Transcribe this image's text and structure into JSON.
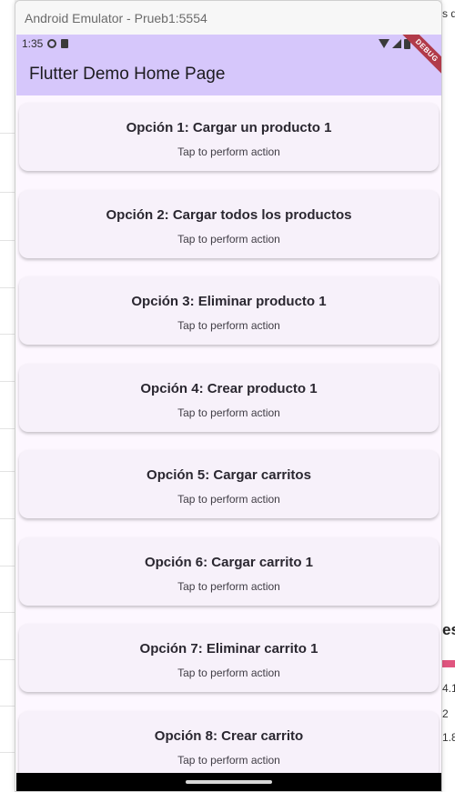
{
  "window": {
    "title": "Android Emulator - Prueb1:5554"
  },
  "status_bar": {
    "time": "1:35"
  },
  "app_bar": {
    "title": "Flutter Demo Home Page",
    "debug_label": "DEBUG"
  },
  "options": [
    {
      "title": "Opción 1: Cargar un producto 1",
      "subtitle": "Tap to perform action"
    },
    {
      "title": "Opción 2: Cargar todos los productos",
      "subtitle": "Tap to perform action"
    },
    {
      "title": "Opción 3: Eliminar producto 1",
      "subtitle": "Tap to perform action"
    },
    {
      "title": "Opción 4: Crear producto 1",
      "subtitle": "Tap to perform action"
    },
    {
      "title": "Opción 5: Cargar carritos",
      "subtitle": "Tap to perform action"
    },
    {
      "title": "Opción 6: Cargar carrito 1",
      "subtitle": "Tap to perform action"
    },
    {
      "title": "Opción 7: Eliminar carrito 1",
      "subtitle": "Tap to perform action"
    },
    {
      "title": "Opción 8: Crear carrito",
      "subtitle": "Tap to perform action"
    }
  ],
  "background": {
    "right_fragments": [
      "s d",
      "es",
      "4.1",
      "2",
      "1.8"
    ]
  },
  "colors": {
    "app_bar": "#d6c7fb",
    "card": "#f7f1fa",
    "screen": "#fdf7ff",
    "debug_banner": "#b13b4a"
  }
}
